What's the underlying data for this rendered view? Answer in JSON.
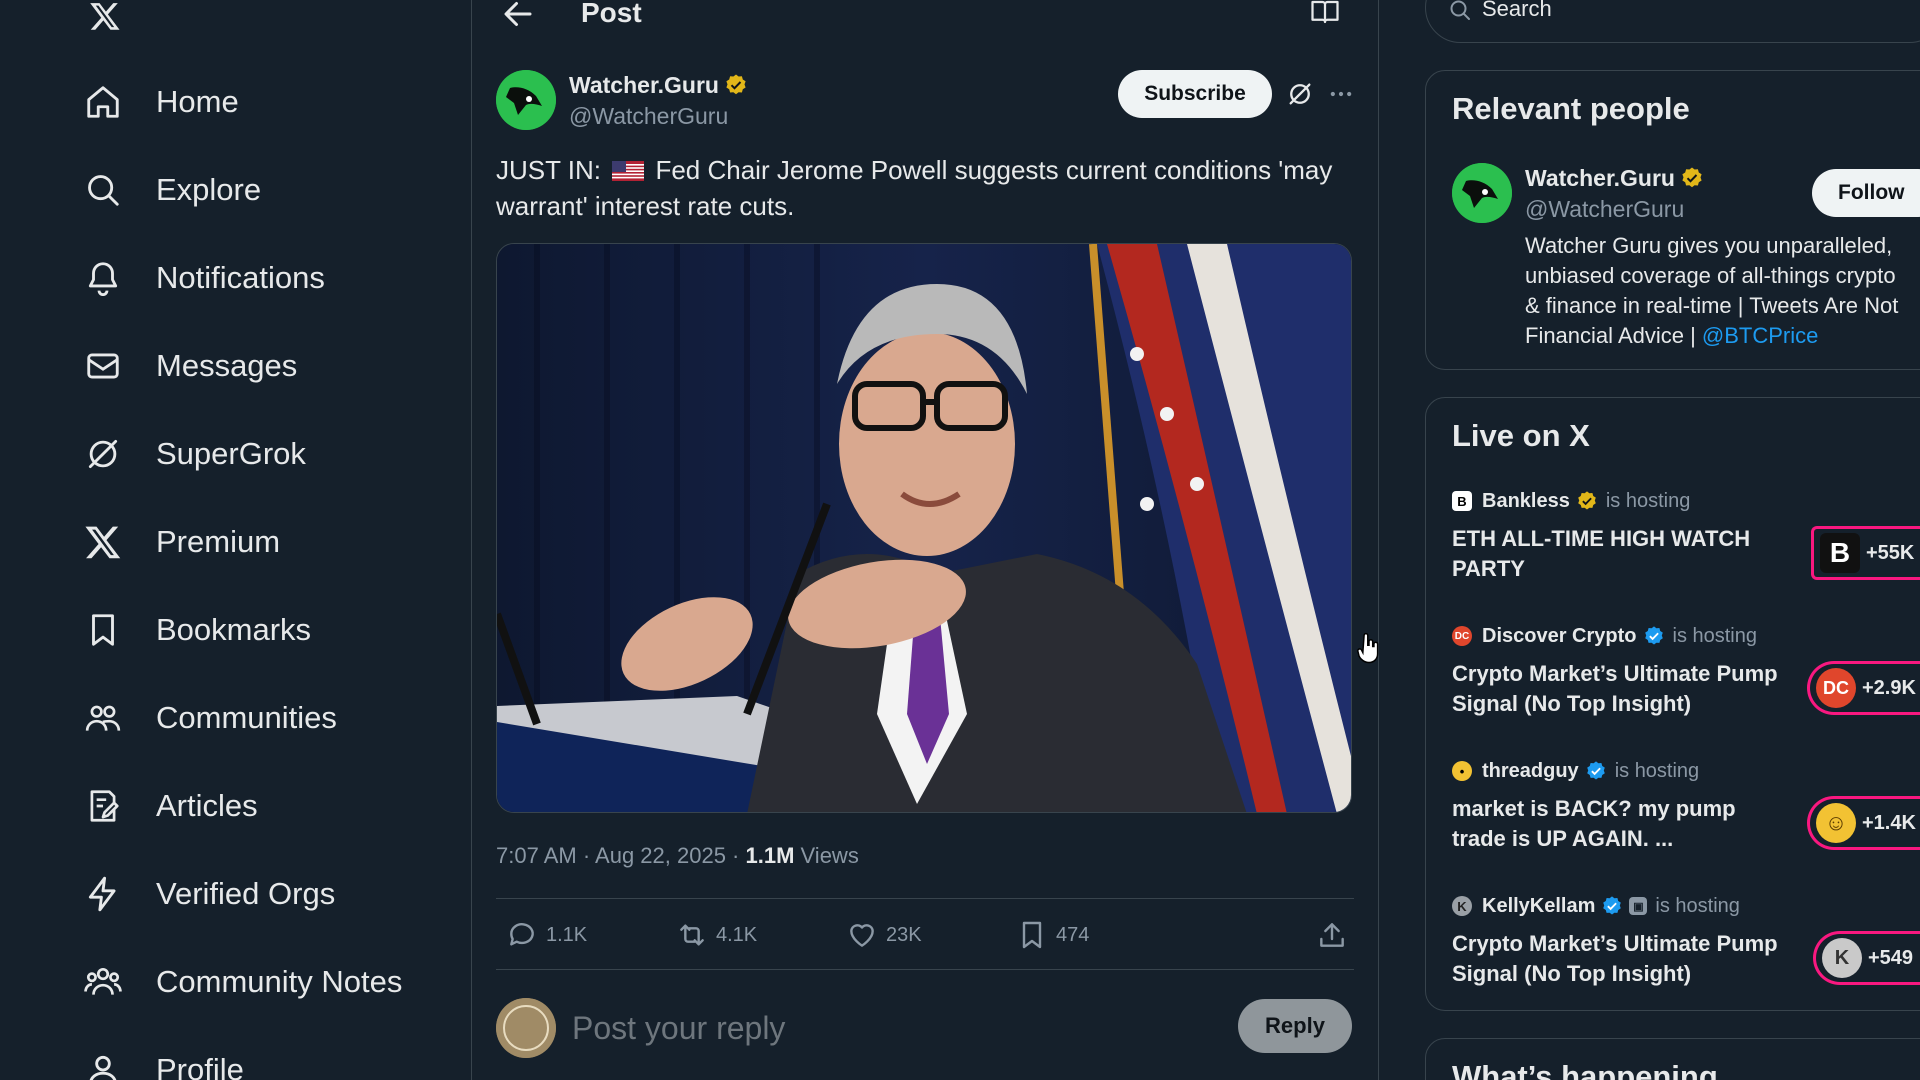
{
  "nav": {
    "items": [
      {
        "id": "home",
        "label": "Home",
        "icon": "home-icon"
      },
      {
        "id": "explore",
        "label": "Explore",
        "icon": "search-icon"
      },
      {
        "id": "notifications",
        "label": "Notifications",
        "icon": "bell-icon"
      },
      {
        "id": "messages",
        "label": "Messages",
        "icon": "envelope-icon"
      },
      {
        "id": "supergrok",
        "label": "SuperGrok",
        "icon": "grok-icon"
      },
      {
        "id": "premium",
        "label": "Premium",
        "icon": "x-logo-icon"
      },
      {
        "id": "bookmarks",
        "label": "Bookmarks",
        "icon": "bookmark-icon"
      },
      {
        "id": "communities",
        "label": "Communities",
        "icon": "people-icon"
      },
      {
        "id": "articles",
        "label": "Articles",
        "icon": "article-icon"
      },
      {
        "id": "verified-orgs",
        "label": "Verified Orgs",
        "icon": "lightning-icon"
      },
      {
        "id": "community-notes",
        "label": "Community Notes",
        "icon": "group-icon"
      },
      {
        "id": "profile",
        "label": "Profile",
        "icon": "person-icon"
      }
    ]
  },
  "header": {
    "title": "Post"
  },
  "post": {
    "author_name": "Watcher.Guru",
    "author_handle": "@WatcherGuru",
    "subscribe_label": "Subscribe",
    "text_prefix": "JUST IN:",
    "text_body": "Fed Chair Jerome Powell suggests current conditions 'may warrant' interest rate cuts.",
    "flag": "us-flag-emoji",
    "time": "7:07 AM · Aug 22, 2025 · ",
    "views_count": "1.1M",
    "views_label": " Views",
    "stats": {
      "replies": "1.1K",
      "reposts": "4.1K",
      "likes": "23K",
      "bookmarks": "474"
    }
  },
  "reply": {
    "placeholder": "Post your reply",
    "button_label": "Reply"
  },
  "search": {
    "placeholder": "Search"
  },
  "relevant": {
    "title": "Relevant people",
    "name": "Watcher.Guru",
    "handle": "@WatcherGuru",
    "follow_label": "Follow",
    "bio_lines": [
      "Watcher Guru gives you unparalleled,",
      "unbiased coverage of all-things crypto",
      "& finance in real-time | Tweets Are Not",
      "Financial Advice | "
    ],
    "bio_link": "@BTCPrice"
  },
  "live": {
    "title": "Live on X",
    "hosting_label": "is hosting",
    "items": [
      {
        "host": "Bankless",
        "badge": "gold",
        "title": "ETH ALL-TIME HIGH WATCH PARTY",
        "count": "+55K"
      },
      {
        "host": "Discover Crypto",
        "badge": "blue",
        "title": "Crypto Market’s Ultimate Pump Signal (No Top Insight)",
        "count": "+2.9K"
      },
      {
        "host": "threadguy",
        "badge": "blue",
        "title": "market is BACK? my pump trade is UP AGAIN. ...",
        "count": "+1.4K"
      },
      {
        "host": "KellyKellam",
        "badge": "blue",
        "title": "Crypto Market’s Ultimate Pump Signal (No Top Insight)",
        "count": "+549"
      }
    ]
  },
  "whats_happening": {
    "title": "What’s happening"
  },
  "colors": {
    "background": "#15202b",
    "accent": "#1d9bf0",
    "live_ring": "#f91880",
    "gold_badge": "#e2b719"
  }
}
